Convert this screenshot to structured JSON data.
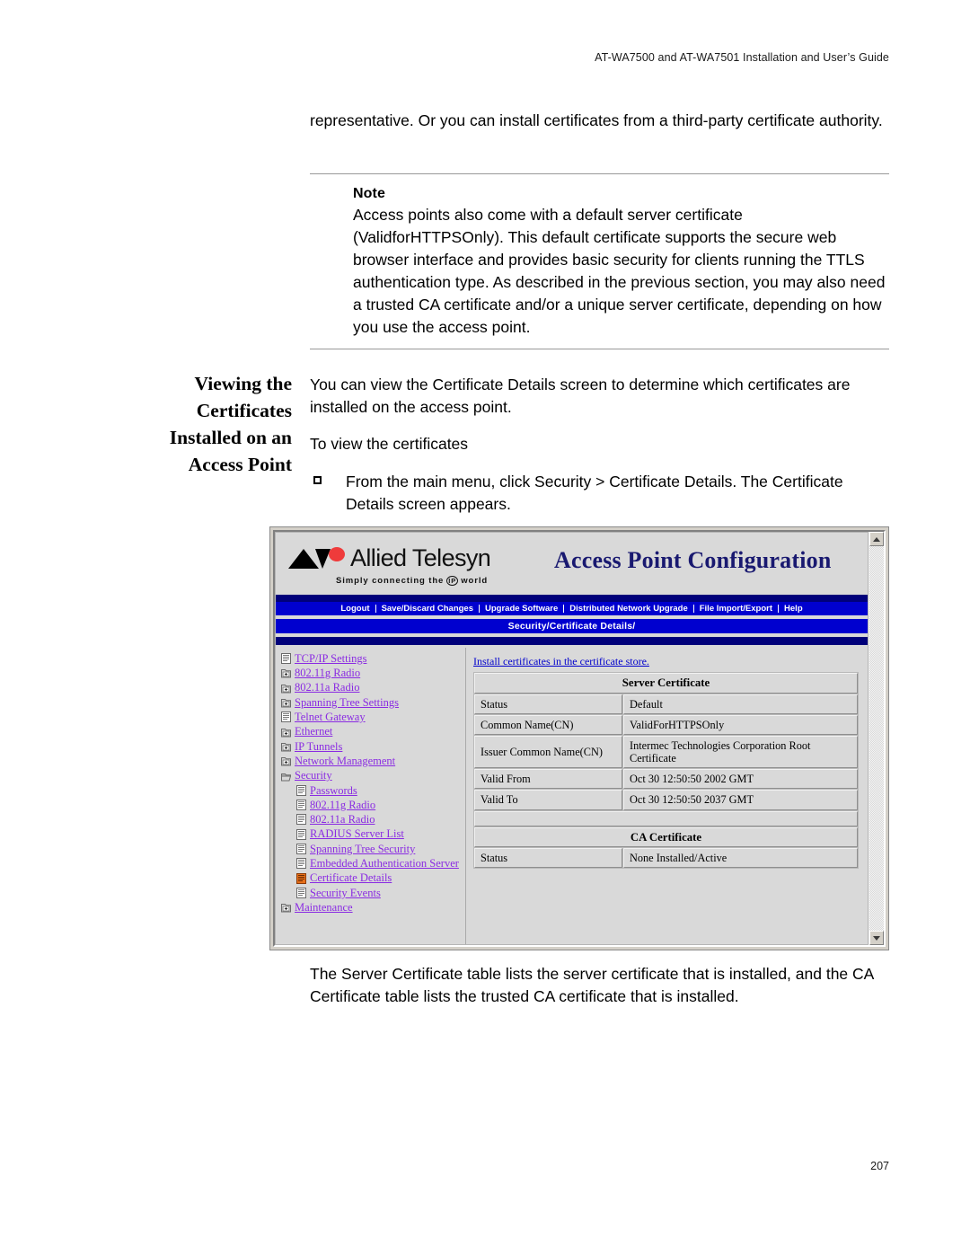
{
  "document": {
    "running_head": "AT-WA7500 and AT-WA7501 Installation and User’s Guide",
    "page_number": "207",
    "intro_paragraph": "representative. Or you can install certificates from a third-party certificate authority.",
    "note": {
      "title": "Note",
      "text": "Access points also come with a default server certificate (ValidforHTTPSOnly). This default certificate supports the secure web browser interface and provides basic security for clients running the TTLS authentication type. As described in the previous section, you may also need a trusted CA certificate and/or a unique server certificate, depending on how you use the access point."
    },
    "section": {
      "heading": "Viewing the Certificates Installed on an Access Point",
      "paragraph": "You can view the Certificate Details screen to determine which certificates are installed on the access point.",
      "subhead": "To view the certificates",
      "step": "From the main menu, click Security > Certificate Details. The Certificate Details screen appears."
    },
    "closing_paragraph": "The Server Certificate table lists the server certificate that is installed, and the CA Certificate table lists the trusted CA certificate that is installed."
  },
  "screenshot": {
    "brand": {
      "name": "Allied Telesyn",
      "tagline_before": "Simply connecting the",
      "tagline_badge": "IP",
      "tagline_after": "world"
    },
    "title": "Access Point Configuration",
    "menu_items": [
      "Logout",
      "Save/Discard Changes",
      "Upgrade Software",
      "Distributed Network Upgrade",
      "File Import/Export",
      "Help"
    ],
    "breadcrumb": "Security/Certificate Details/",
    "tree": [
      {
        "label": "TCP/IP Settings",
        "icon": "page-icon",
        "indent": 0,
        "state": "normal"
      },
      {
        "label": "802.11g Radio",
        "icon": "folder-closed-icon",
        "indent": 0,
        "state": "normal"
      },
      {
        "label": "802.11a Radio",
        "icon": "folder-closed-icon",
        "indent": 0,
        "state": "normal"
      },
      {
        "label": "Spanning Tree Settings",
        "icon": "folder-closed-icon",
        "indent": 0,
        "state": "normal"
      },
      {
        "label": "Telnet Gateway",
        "icon": "page-icon",
        "indent": 0,
        "state": "normal"
      },
      {
        "label": "Ethernet",
        "icon": "folder-closed-icon",
        "indent": 0,
        "state": "normal"
      },
      {
        "label": "IP Tunnels",
        "icon": "folder-closed-icon",
        "indent": 0,
        "state": "normal"
      },
      {
        "label": "Network Management",
        "icon": "folder-closed-icon",
        "indent": 0,
        "state": "normal"
      },
      {
        "label": "Security",
        "icon": "folder-open-icon",
        "indent": 0,
        "state": "expanded"
      },
      {
        "label": "Passwords",
        "icon": "page-icon",
        "indent": 1,
        "state": "normal"
      },
      {
        "label": "802.11g Radio",
        "icon": "page-icon",
        "indent": 1,
        "state": "normal"
      },
      {
        "label": "802.11a Radio",
        "icon": "page-icon",
        "indent": 1,
        "state": "normal"
      },
      {
        "label": "RADIUS Server List",
        "icon": "page-icon",
        "indent": 1,
        "state": "normal"
      },
      {
        "label": "Spanning Tree Security",
        "icon": "page-icon",
        "indent": 1,
        "state": "normal"
      },
      {
        "label": "Embedded Authentication Server",
        "icon": "page-icon",
        "indent": 1,
        "state": "normal"
      },
      {
        "label": "Certificate Details",
        "icon": "page-selected-icon",
        "indent": 1,
        "state": "selected"
      },
      {
        "label": "Security Events",
        "icon": "page-icon",
        "indent": 1,
        "state": "normal"
      },
      {
        "label": "Maintenance",
        "icon": "folder-closed-icon",
        "indent": 0,
        "state": "normal"
      }
    ],
    "store_link": "Install certificates in the certificate store.",
    "server_certificate": {
      "header": "Server Certificate",
      "rows": [
        {
          "label": "Status",
          "value": "Default"
        },
        {
          "label": "Common Name(CN)",
          "value": "ValidForHTTPSOnly"
        },
        {
          "label": "Issuer Common Name(CN)",
          "value": "Intermec Technologies Corporation Root Certificate"
        },
        {
          "label": "Valid From",
          "value": "Oct 30 12:50:50 2002 GMT"
        },
        {
          "label": "Valid To",
          "value": "Oct 30 12:50:50 2037 GMT"
        }
      ]
    },
    "ca_certificate": {
      "header": "CA Certificate",
      "rows": [
        {
          "label": "Status",
          "value": "None Installed/Active"
        }
      ]
    },
    "scrollbar": {
      "up_icon": "scroll-up-arrow-icon",
      "down_icon": "scroll-down-arrow-icon"
    },
    "colors": {
      "title_navy": "#191970",
      "bar_blue": "#0000cf",
      "bar_navy": "#00007a",
      "link_purple": "#8a2be2",
      "link_blue": "#0000cd",
      "chrome_gray": "#d9d9d9",
      "selected_orange": "#e8701a"
    }
  }
}
